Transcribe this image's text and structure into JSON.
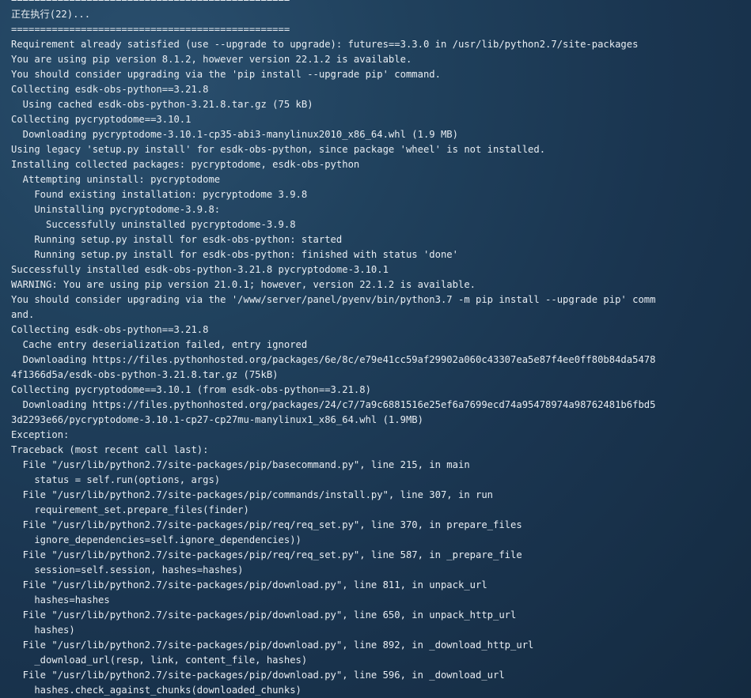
{
  "terminal": {
    "lines": [
      "================================================",
      "正在执行(22)...",
      "================================================",
      "Requirement already satisfied (use --upgrade to upgrade): futures==3.3.0 in /usr/lib/python2.7/site-packages",
      "You are using pip version 8.1.2, however version 22.1.2 is available.",
      "You should consider upgrading via the 'pip install --upgrade pip' command.",
      "Collecting esdk-obs-python==3.21.8",
      "  Using cached esdk-obs-python-3.21.8.tar.gz (75 kB)",
      "Collecting pycryptodome==3.10.1",
      "  Downloading pycryptodome-3.10.1-cp35-abi3-manylinux2010_x86_64.whl (1.9 MB)",
      "Using legacy 'setup.py install' for esdk-obs-python, since package 'wheel' is not installed.",
      "Installing collected packages: pycryptodome, esdk-obs-python",
      "  Attempting uninstall: pycryptodome",
      "    Found existing installation: pycryptodome 3.9.8",
      "    Uninstalling pycryptodome-3.9.8:",
      "      Successfully uninstalled pycryptodome-3.9.8",
      "    Running setup.py install for esdk-obs-python: started",
      "    Running setup.py install for esdk-obs-python: finished with status 'done'",
      "Successfully installed esdk-obs-python-3.21.8 pycryptodome-3.10.1",
      "WARNING: You are using pip version 21.0.1; however, version 22.1.2 is available.",
      "You should consider upgrading via the '/www/server/panel/pyenv/bin/python3.7 -m pip install --upgrade pip' comm",
      "and.",
      "Collecting esdk-obs-python==3.21.8",
      "  Cache entry deserialization failed, entry ignored",
      "  Downloading https://files.pythonhosted.org/packages/6e/8c/e79e41cc59af29902a060c43307ea5e87f4ee0ff80b84da5478",
      "4f1366d5a/esdk-obs-python-3.21.8.tar.gz (75kB)",
      "Collecting pycryptodome==3.10.1 (from esdk-obs-python==3.21.8)",
      "  Downloading https://files.pythonhosted.org/packages/24/c7/7a9c6881516e25ef6a7699ecd74a95478974a98762481b6fbd5",
      "3d2293e66/pycryptodome-3.10.1-cp27-cp27mu-manylinux1_x86_64.whl (1.9MB)",
      "Exception:",
      "Traceback (most recent call last):",
      "  File \"/usr/lib/python2.7/site-packages/pip/basecommand.py\", line 215, in main",
      "    status = self.run(options, args)",
      "  File \"/usr/lib/python2.7/site-packages/pip/commands/install.py\", line 307, in run",
      "    requirement_set.prepare_files(finder)",
      "  File \"/usr/lib/python2.7/site-packages/pip/req/req_set.py\", line 370, in prepare_files",
      "    ignore_dependencies=self.ignore_dependencies))",
      "  File \"/usr/lib/python2.7/site-packages/pip/req/req_set.py\", line 587, in _prepare_file",
      "    session=self.session, hashes=hashes)",
      "  File \"/usr/lib/python2.7/site-packages/pip/download.py\", line 811, in unpack_url",
      "    hashes=hashes",
      "  File \"/usr/lib/python2.7/site-packages/pip/download.py\", line 650, in unpack_http_url",
      "    hashes)",
      "  File \"/usr/lib/python2.7/site-packages/pip/download.py\", line 892, in _download_http_url",
      "    _download_url(resp, link, content_file, hashes)",
      "  File \"/usr/lib/python2.7/site-packages/pip/download.py\", line 596, in _download_url",
      "    hashes.check_against_chunks(downloaded_chunks)"
    ]
  }
}
